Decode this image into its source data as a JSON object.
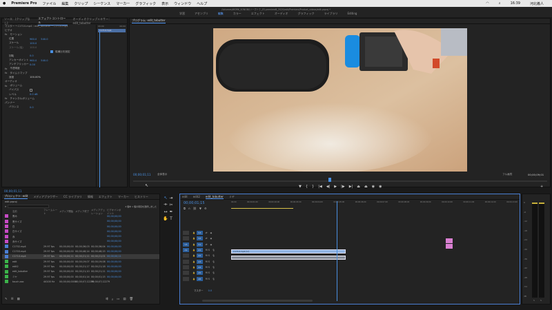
{
  "menubar": {
    "app": "Premiere Pro",
    "items": [
      "ファイル",
      "編集",
      "クリップ",
      "シーケンス",
      "マーカー",
      "グラフィック",
      "表示",
      "ウィンドウ",
      "ヘルプ"
    ],
    "clock": "16:39",
    "user": "河北義人"
  },
  "window": {
    "path": "/Volumes/WORK_SONOBI/ソーグトク_ZS.premiereB_2020/edit/Premiere/Product_videos/edit.prproj *",
    "workspaces": [
      "学習",
      "アセンブリ",
      "編集",
      "カラー",
      "エフェクト",
      "オーディオ",
      "グラフィック",
      "ライブラリ",
      "Editing"
    ],
    "active_workspace": "編集"
  },
  "effect_controls": {
    "tabs": [
      "ソース：(クリップなし)",
      "エフェクトコントロール",
      "オーディオクリップミキサー：edit_tobutter"
    ],
    "header": "マスター * C1710.mp4 › edit_tobutter * C1710.mp4",
    "video_label": "ビデオ",
    "motion": "モーション",
    "position": {
      "label": "位置",
      "x": "960.0",
      "y": "540.0"
    },
    "scale": {
      "label": "スケール",
      "value": "100.0"
    },
    "scale_width": {
      "label": "スケール(幅)",
      "value": "100.0"
    },
    "uniform": "縦横比を固定",
    "rotation": {
      "label": "回転",
      "value": "0.0"
    },
    "anchor": {
      "label": "アンカーポイント",
      "x": "960.0",
      "y": "540.0"
    },
    "flicker": {
      "label": "アンチフリッカー",
      "value": "0.00"
    },
    "opacity": "不透明度",
    "time_remap": "タイムリマップ",
    "speed": {
      "label": "速度",
      "value": "100.00%"
    },
    "audio_label": "オーディオ",
    "volume": "ボリューム",
    "bypass": "バイパス",
    "level": {
      "label": "レベル",
      "value": "0.0 dB"
    },
    "channel_volume": "チャンネルボリューム",
    "panner": "パンナー",
    "balance": {
      "label": "バランス",
      "value": "0.0"
    },
    "timecode": "00;00;01;11",
    "clip_time": "00;00",
    "clip_name": "C1710.mp4",
    "clip_time2": "00;00"
  },
  "program_monitor": {
    "tab": "プログラム: edit_tobutter",
    "timecode": "00;00;01;11",
    "fit": "全体表示",
    "quality": "フル画質",
    "duration": "00;00;09;01"
  },
  "project": {
    "tabs": [
      "プロジェクト: edit",
      "メディアブラウザー",
      "CC ライブラリ",
      "情報",
      "エフェクト",
      "マーカー",
      "ヒストリー"
    ],
    "filename": "edit.prproj",
    "search_placeholder": "",
    "item_count": "2 個中 1 個の項目を選択しました",
    "columns": [
      "名前",
      "フレームレート",
      "メディア開始",
      "メディア終了",
      "メディアデュレーション",
      "ビデオインポイント"
    ],
    "rows": [
      {
        "name": "黒み",
        "color": "#c64ac4",
        "fps": "",
        "start": "",
        "end": "",
        "dur": "",
        "vin": "00;00;00;00"
      },
      {
        "name": "黒サイズ",
        "color": "#c64ac4",
        "fps": "",
        "start": "",
        "end": "",
        "dur": "",
        "vin": "00;00;00;00"
      },
      {
        "name": "白",
        "color": "#c64ac4",
        "fps": "",
        "start": "",
        "end": "",
        "dur": "",
        "vin": "00;00;00;00"
      },
      {
        "name": "白サイズ",
        "color": "#c64ac4",
        "fps": "",
        "start": "",
        "end": "",
        "dur": "",
        "vin": "00;00;00;00"
      },
      {
        "name": "赤",
        "color": "#c64ac4",
        "fps": "",
        "start": "",
        "end": "",
        "dur": "",
        "vin": "00;00;00;00"
      },
      {
        "name": "赤サイズ",
        "color": "#c64ac4",
        "fps": "",
        "start": "",
        "end": "",
        "dur": "",
        "vin": "00;00;00;00"
      },
      {
        "name": "C1702.mp4",
        "color": "#4a7fd4",
        "fps": "29.97 fps",
        "start": "00;00;00;00",
        "end": "00;00;36;03",
        "dur": "00;00;36;04",
        "vin": "00;00;00;00"
      },
      {
        "name": "C1703.mp4",
        "color": "#4a7fd4",
        "fps": "29.97 fps",
        "start": "00;00;00;00",
        "end": "00;00;48;14",
        "dur": "00;00;48;15",
        "vin": "00;00;00;00"
      },
      {
        "name": "C1710.mp4",
        "color": "#4a7fd4",
        "fps": "29.97 fps",
        "start": "00;00;00;11",
        "end": "00;00;21;11",
        "dur": "00;00;21;01",
        "vin": "00;00;00;11"
      },
      {
        "name": "edit",
        "color": "#3cb34a",
        "fps": "29.97 fps",
        "start": "00;00;00;00",
        "end": "00;00;19;07",
        "dur": "00;00;19;08",
        "vin": "00;00;00;00"
      },
      {
        "name": "edit2",
        "color": "#3cb34a",
        "fps": "29.97 fps",
        "start": "00;00;00;00",
        "end": "00;00;21;17",
        "dur": "00;00;21;18",
        "vin": "00;00;00;00"
      },
      {
        "name": "edit_tobutter",
        "color": "#3cb34a",
        "fps": "29.97 fps",
        "start": "00;00;00;00",
        "end": "00;00;21;10",
        "dur": "00;00;21;11",
        "vin": "00;00;00;00"
      },
      {
        "name": "ミヤ",
        "color": "#3cb34a",
        "fps": "29.97 fps",
        "start": "00;00;00;00",
        "end": "00;00;01;14",
        "dur": "00;00;01;15",
        "vin": "00;00;00;00"
      },
      {
        "name": "touch.aac",
        "color": "#3cb34a",
        "fps": "44100 Hz",
        "start": "00;00;00;0000",
        "end": "00;00;07;12279",
        "dur": "00;00;07;12279",
        "vin": ""
      }
    ]
  },
  "timeline": {
    "tabs": [
      "edit",
      "edit2",
      "edit_tobutter",
      "ミヤ"
    ],
    "active_tab": "edit_tobutter",
    "timecode": "00;00;01;15",
    "ruler": [
      "00;00",
      "00;00;01;00",
      "00;00;02;00",
      "00;00;03;00",
      "00;00;04;00",
      "00;00;05;00",
      "00;00;06;00",
      "00;00;07;00",
      "00;00;08;00",
      "00;00;09;00",
      "00;00;10;00",
      "00;00;11;00",
      "00;00;12;00",
      "00;00;13;00"
    ],
    "tracks": [
      "V3",
      "V2",
      "V1",
      "A1",
      "A2",
      "A3",
      "A4",
      "A5",
      "A6"
    ],
    "master": "マスター",
    "master_val": "0.0",
    "clip_v": "C1710.mp4 [V]",
    "clip_a": ""
  },
  "meter": {
    "labels": [
      "0",
      "-6",
      "-12",
      "-18",
      "-24",
      "-30",
      "-36",
      "-42",
      "-48",
      "-54",
      "dB"
    ],
    "s": "S",
    "s2": "S"
  }
}
